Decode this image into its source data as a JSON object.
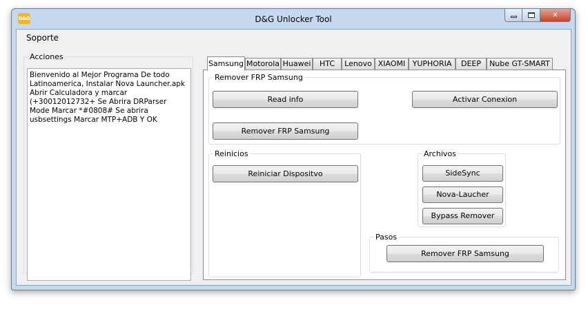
{
  "window": {
    "title": "D&G Unlocker Tool",
    "icon_label": "D&G"
  },
  "menu": {
    "soporte": "Soporte"
  },
  "acciones": {
    "legend": "Acciones",
    "text": "Bienvenido al Mejor Programa De todo Latinoamerica, Instalar Nova Launcher.apk  Abrir Calculadora y marcar (+30012012732+  Se Abrira DRParser Mode Marcar *#0808# Se abrira usbsettings Marcar MTP+ADB Y OK"
  },
  "tabs": [
    "Samsung",
    "Motorola",
    "Huawei",
    "HTC",
    "Lenovo",
    "XIAOMI",
    "YUPHORIA",
    "DEEP",
    "Nube GT-SMART"
  ],
  "samsung": {
    "frp_group": {
      "legend": "Remover FRP Samsung",
      "read_info": "Read info",
      "activar_conexion": "Activar Conexion",
      "remover_frp": "Remover FRP Samsung"
    },
    "reinicios": {
      "legend": "Reinicios",
      "reiniciar": "Reiniciar Dispositvo"
    },
    "archivos": {
      "legend": "Archivos",
      "sidesync": "SideSync",
      "nova": "Nova-Laucher",
      "bypass": "Bypass Remover"
    },
    "pasos": {
      "legend": "Pasos",
      "remover_frp": "Remover FRP Samsung"
    }
  }
}
